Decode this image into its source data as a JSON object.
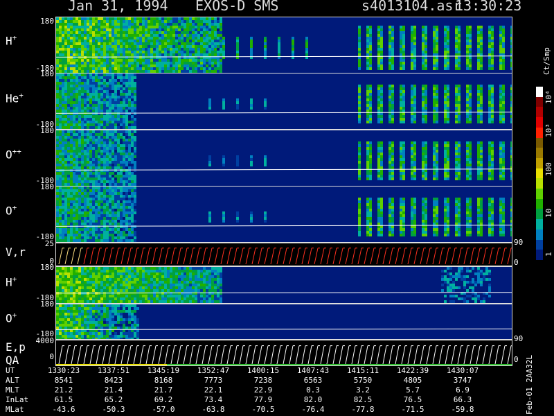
{
  "header": {
    "date": "Jan 31, 1994",
    "instrument": "EXOS-D SMS",
    "file": "s4013104.asr",
    "time": "13:30:23"
  },
  "panels": [
    {
      "label": "H",
      "charge": "+",
      "top_tick": "180",
      "bot_tick": "-180"
    },
    {
      "label": "He",
      "charge": "+",
      "top_tick": "180",
      "bot_tick": "-180"
    },
    {
      "label": "O",
      "charge": "++",
      "top_tick": "180",
      "bot_tick": "-180"
    },
    {
      "label": "O",
      "charge": "+",
      "top_tick": "180",
      "bot_tick": "-180"
    },
    {
      "label": "V,r",
      "charge": "",
      "top_tick": "25",
      "bot_tick": "0"
    },
    {
      "label": "H",
      "charge": "+",
      "top_tick": "180",
      "bot_tick": "-180"
    },
    {
      "label": "O",
      "charge": "+",
      "top_tick": "180",
      "bot_tick": "-180"
    },
    {
      "label": "E,p",
      "charge": "",
      "top_tick": "4000",
      "bot_tick": "0"
    }
  ],
  "qa_label": "QA",
  "right_ticks": [
    {
      "text": "90"
    },
    {
      "text": "0"
    },
    {
      "text": "90"
    },
    {
      "text": "0"
    }
  ],
  "colorbar": {
    "unit": "Ct/Smp",
    "ticks": [
      "10⁴",
      "10³",
      "100",
      "10",
      "1"
    ],
    "colors": [
      "#ffffff",
      "#7f0000",
      "#b00000",
      "#e00000",
      "#ff2000",
      "#7a5a00",
      "#9a7a00",
      "#c0a000",
      "#e8e000",
      "#b8e000",
      "#60d000",
      "#20b000",
      "#00a040",
      "#00b0a0",
      "#0080c0",
      "#0040a0",
      "#001a7a"
    ]
  },
  "side_note": "Feb-01 2AA32L",
  "footer": {
    "rows": [
      {
        "label": "UT",
        "values": [
          "1330:23",
          "1337:51",
          "1345:19",
          "1352:47",
          "1400:15",
          "1407:43",
          "1415:11",
          "1422:39",
          "1430:07"
        ]
      },
      {
        "label": "ALT",
        "values": [
          "8541",
          "8423",
          "8168",
          "7773",
          "7238",
          "6563",
          "5750",
          "4805",
          "3747"
        ]
      },
      {
        "label": "MLT",
        "values": [
          "21.2",
          "21.4",
          "21.7",
          "22.1",
          "22.9",
          "0.3",
          "3.2",
          "5.7",
          "6.9"
        ]
      },
      {
        "label": "InLat",
        "values": [
          "61.5",
          "65.2",
          "69.2",
          "73.4",
          "77.9",
          "82.0",
          "82.5",
          "76.5",
          "66.3"
        ]
      },
      {
        "label": "MLat",
        "values": [
          "-43.6",
          "-50.3",
          "-57.0",
          "-63.8",
          "-70.5",
          "-76.4",
          "-77.8",
          "-71.5",
          "-59.8"
        ]
      }
    ]
  },
  "chart_data": {
    "type": "heatmap",
    "title": "Jan 31, 1994   EXOS-D SMS",
    "x_ticks": [
      "1330:23",
      "1337:51",
      "1345:19",
      "1352:47",
      "1400:15",
      "1407:43",
      "1415:11",
      "1422:39",
      "1430:07"
    ],
    "series": [
      {
        "name": "H+",
        "ylim": [
          -180,
          180
        ]
      },
      {
        "name": "He+",
        "ylim": [
          -180,
          180
        ]
      },
      {
        "name": "O++",
        "ylim": [
          -180,
          180
        ]
      },
      {
        "name": "O+",
        "ylim": [
          -180,
          180
        ]
      },
      {
        "name": "V,r",
        "ylim": [
          0,
          25
        ]
      },
      {
        "name": "H+",
        "ylim": [
          -180,
          180
        ]
      },
      {
        "name": "O+",
        "ylim": [
          -180,
          180
        ]
      },
      {
        "name": "E,p",
        "ylim": [
          0,
          4000
        ]
      }
    ],
    "colorbar_unit": "Ct/Smp",
    "colorbar_range": [
      1,
      10000
    ],
    "colorbar_scale": "log"
  }
}
